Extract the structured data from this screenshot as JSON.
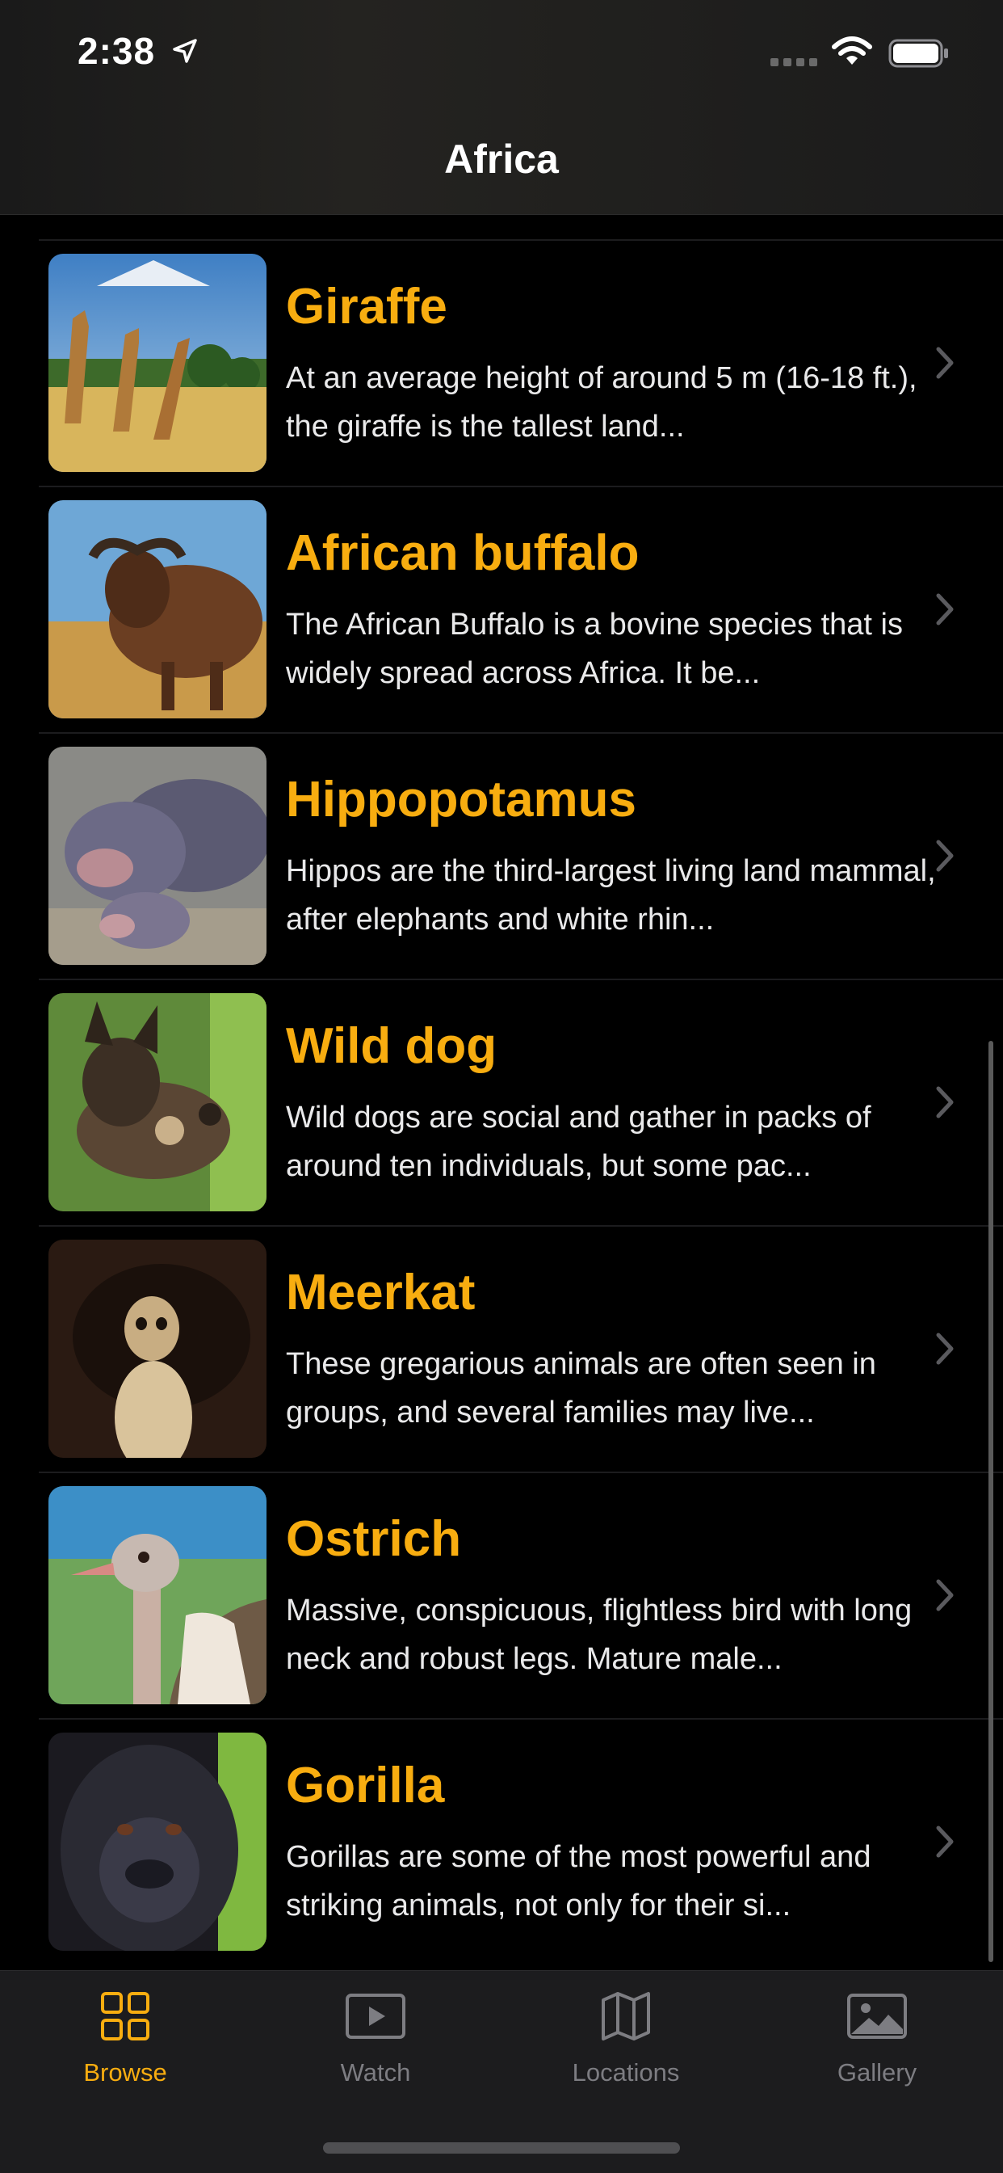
{
  "status": {
    "time": "2:38"
  },
  "nav": {
    "title": "Africa"
  },
  "animals": [
    {
      "name": "Giraffe",
      "description": "At an average height of around 5 m (16-18 ft.), the giraffe is the tallest land..."
    },
    {
      "name": "African buffalo",
      "description": "The African Buffalo is a bovine species that is widely spread across Africa. It be..."
    },
    {
      "name": "Hippopotamus",
      "description": "Hippos are the third-largest living land mammal, after elephants and white rhin..."
    },
    {
      "name": "Wild dog",
      "description": "Wild dogs are social and gather in packs of around ten individuals, but some pac..."
    },
    {
      "name": "Meerkat",
      "description": "These gregarious animals are often seen in groups, and several families may live..."
    },
    {
      "name": "Ostrich",
      "description": "Massive, conspicuous, flightless bird with long neck and robust legs. Mature male..."
    },
    {
      "name": "Gorilla",
      "description": "Gorillas are some of the most powerful and striking animals, not only for their si..."
    }
  ],
  "tabs": [
    {
      "label": "Browse",
      "icon": "grid-icon",
      "active": true
    },
    {
      "label": "Watch",
      "icon": "play-icon",
      "active": false
    },
    {
      "label": "Locations",
      "icon": "map-icon",
      "active": false
    },
    {
      "label": "Gallery",
      "icon": "photo-icon",
      "active": false
    }
  ],
  "colors": {
    "accent": "#f8ad10",
    "background": "#000000",
    "tab_inactive": "#7d7d82"
  }
}
